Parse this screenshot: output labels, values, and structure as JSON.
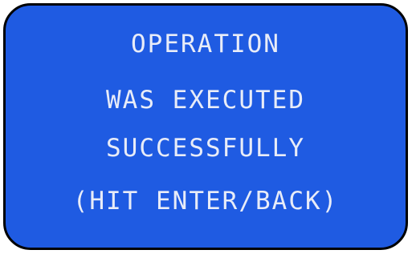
{
  "message": {
    "lines": [
      "OPERATION",
      "WAS EXECUTED",
      "SUCCESSFULLY",
      "(HIT ENTER/BACK)"
    ]
  },
  "colors": {
    "screen_background": "#1f5be2",
    "text": "#e8ecf8",
    "border": "#000000"
  }
}
